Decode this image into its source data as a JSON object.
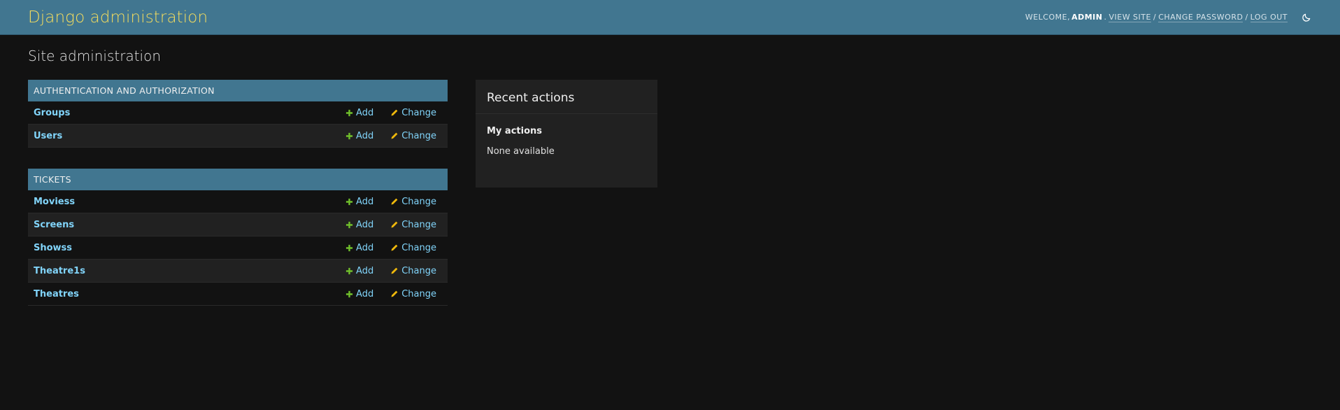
{
  "header": {
    "site_title": "Django administration",
    "welcome_prefix": "Welcome,",
    "username": "admin",
    "view_site": "View site",
    "change_password": "Change password",
    "log_out": "Log out",
    "separator": "/",
    "theme_icon": "moon-icon"
  },
  "page": {
    "title": "Site administration"
  },
  "apps": [
    {
      "caption": "Authentication and Authorization",
      "models": [
        {
          "name": "Groups",
          "add": "Add",
          "change": "Change"
        },
        {
          "name": "Users",
          "add": "Add",
          "change": "Change"
        }
      ]
    },
    {
      "caption": "Tickets",
      "models": [
        {
          "name": "Moviess",
          "add": "Add",
          "change": "Change"
        },
        {
          "name": "Screens",
          "add": "Add",
          "change": "Change"
        },
        {
          "name": "Showss",
          "add": "Add",
          "change": "Change"
        },
        {
          "name": "Theatre1s",
          "add": "Add",
          "change": "Change"
        },
        {
          "name": "Theatres",
          "add": "Add",
          "change": "Change"
        }
      ]
    }
  ],
  "recent_actions": {
    "title": "Recent actions",
    "my_actions_label": "My actions",
    "empty_text": "None available"
  },
  "colors": {
    "header_bg": "#417690",
    "brand": "#f5dd5d",
    "link": "#81d4fa",
    "add_icon": "#70bf2b",
    "change_icon": "#efb80b",
    "page_bg": "#121212"
  }
}
